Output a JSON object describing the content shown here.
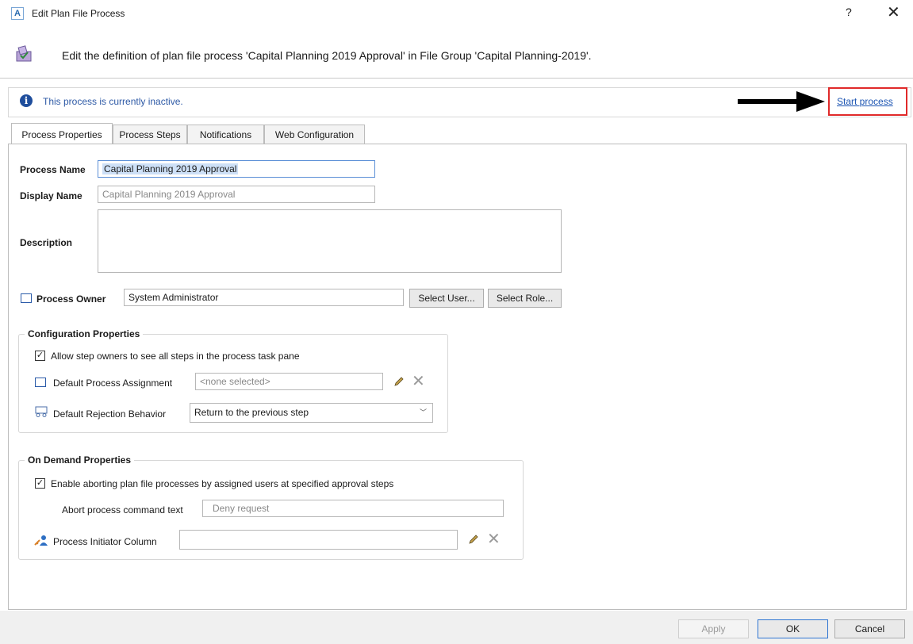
{
  "window": {
    "title": "Edit Plan File Process",
    "app_icon": "A",
    "help_glyph": "?",
    "close_glyph": "✕"
  },
  "header": {
    "description": "Edit the definition of plan file process 'Capital Planning 2019 Approval' in File Group 'Capital Planning-2019'."
  },
  "status": {
    "text": "This process is currently inactive.",
    "link": "Start process"
  },
  "tabs": [
    {
      "label": "Process Properties"
    },
    {
      "label": "Process Steps"
    },
    {
      "label": "Notifications"
    },
    {
      "label": "Web Configuration"
    }
  ],
  "form": {
    "process_name_label": "Process Name",
    "process_name_value": "Capital Planning 2019 Approval",
    "display_name_label": "Display Name",
    "display_name_placeholder": "Capital Planning 2019 Approval",
    "description_label": "Description",
    "description_value": "",
    "process_owner_label": "Process Owner",
    "process_owner_value": "System Administrator",
    "select_user_label": "Select User...",
    "select_role_label": "Select Role..."
  },
  "config": {
    "title": "Configuration Properties",
    "allow_see_all_label": "Allow step owners to see all steps in the process task pane",
    "allow_see_all_checked": true,
    "default_assignment_label": "Default Process Assignment",
    "default_assignment_placeholder": "<none selected>",
    "default_rejection_label": "Default Rejection Behavior",
    "default_rejection_value": "Return to the previous step"
  },
  "on_demand": {
    "title": "On Demand Properties",
    "enable_abort_label": "Enable aborting plan file processes by assigned users at specified approval steps",
    "enable_abort_checked": true,
    "abort_text_label": "Abort process command text",
    "abort_text_placeholder": "Deny request",
    "initiator_label": "Process Initiator Column",
    "initiator_value": ""
  },
  "buttons": {
    "apply": "Apply",
    "ok": "OK",
    "cancel": "Cancel"
  },
  "colors": {
    "link": "#1e56b3",
    "status_text": "#2e5aa6",
    "highlight_box": "#e02a2a"
  }
}
